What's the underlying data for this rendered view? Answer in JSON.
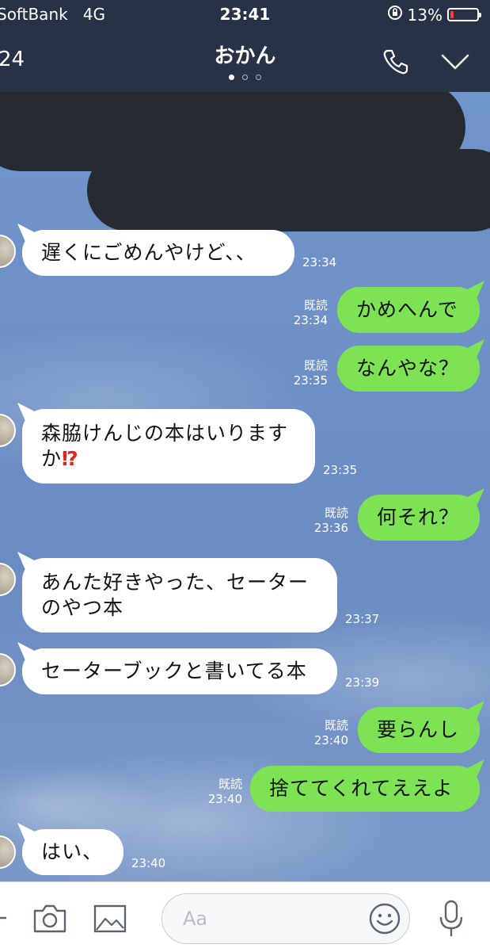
{
  "status_bar": {
    "carrier": "SoftBank",
    "network": "4G",
    "time": "23:41",
    "battery": "13%",
    "battery_level": 0.13
  },
  "header": {
    "back_count": "24",
    "title": "おかん"
  },
  "messages": [
    {
      "dir": "in",
      "text": "遅くにごめんやけど、、",
      "time": "23:34"
    },
    {
      "dir": "out",
      "text": "かめへんで",
      "read": "既読",
      "time": "23:34"
    },
    {
      "dir": "out",
      "text": "なんやな？",
      "read": "既読",
      "time": "23:35"
    },
    {
      "dir": "in",
      "text": "森脇けんじの本はいります\nか",
      "emoji": "⁉",
      "time": "23:35"
    },
    {
      "dir": "out",
      "text": "何それ？",
      "read": "既読",
      "time": "23:36"
    },
    {
      "dir": "in",
      "text": "あんた好きやった、セーター\nのやつ本",
      "time": "23:37"
    },
    {
      "dir": "in",
      "text": "セーターブックと書いてる本",
      "time": "23:39"
    },
    {
      "dir": "out",
      "text": "要らんし",
      "read": "既読",
      "time": "23:40"
    },
    {
      "dir": "out",
      "text": "捨ててくれてええよ",
      "read": "既読",
      "time": "23:40"
    },
    {
      "dir": "in",
      "text": "はい、",
      "time": "23:40"
    }
  ],
  "input": {
    "placeholder": "Aa"
  },
  "icons": [
    "phone-icon",
    "chevron-down-icon",
    "camera-icon",
    "image-icon",
    "emoji-icon",
    "microphone-icon",
    "plus-icon",
    "lock-rotation-icon"
  ],
  "colors": {
    "header_bg": "#283246",
    "bubble_out": "#7de354",
    "bubble_in": "#ffffff",
    "battery_low": "#ff3b30"
  }
}
